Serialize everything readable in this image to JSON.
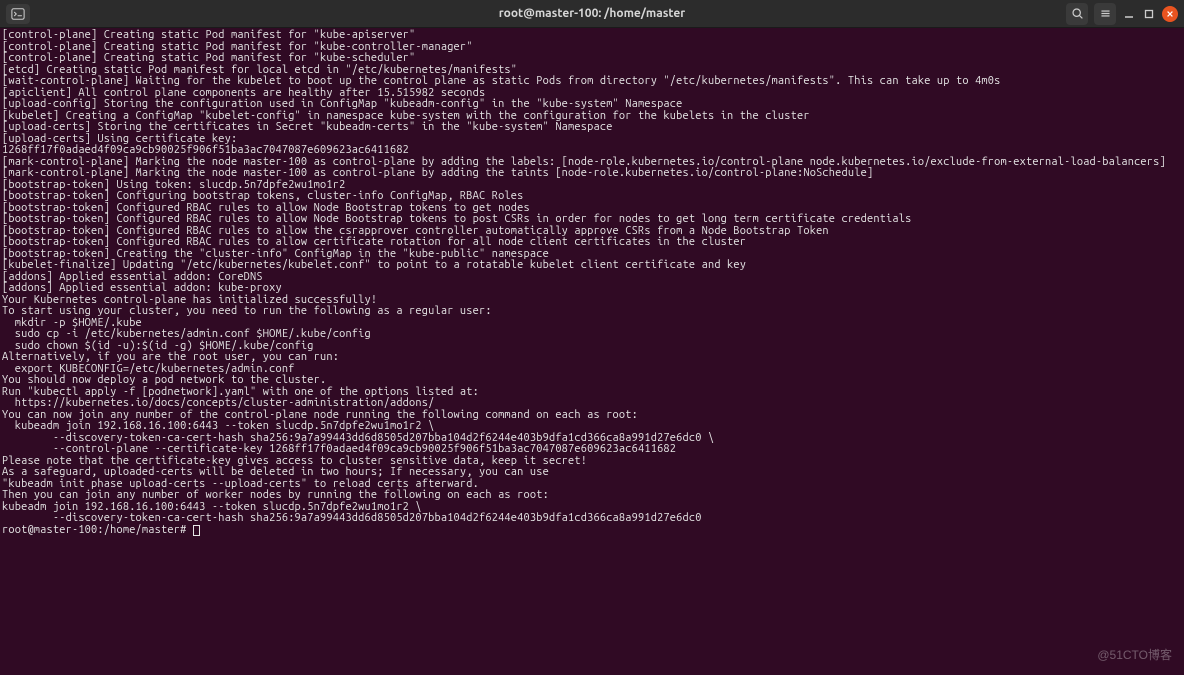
{
  "window": {
    "title": "root@master-100: /home/master"
  },
  "titlebar": {
    "newtab_icon": "⊕"
  },
  "watermark": "@51CTO博客",
  "terminal": {
    "lines": [
      "[control-plane] Creating static Pod manifest for \"kube-apiserver\"",
      "[control-plane] Creating static Pod manifest for \"kube-controller-manager\"",
      "[control-plane] Creating static Pod manifest for \"kube-scheduler\"",
      "[etcd] Creating static Pod manifest for local etcd in \"/etc/kubernetes/manifests\"",
      "[wait-control-plane] Waiting for the kubelet to boot up the control plane as static Pods from directory \"/etc/kubernetes/manifests\". This can take up to 4m0s",
      "[apiclient] All control plane components are healthy after 15.515982 seconds",
      "[upload-config] Storing the configuration used in ConfigMap \"kubeadm-config\" in the \"kube-system\" Namespace",
      "[kubelet] Creating a ConfigMap \"kubelet-config\" in namespace kube-system with the configuration for the kubelets in the cluster",
      "[upload-certs] Storing the certificates in Secret \"kubeadm-certs\" in the \"kube-system\" Namespace",
      "[upload-certs] Using certificate key:",
      "1268ff17f0adaed4f09ca9cb90025f906f51ba3ac7047087e609623ac6411682",
      "[mark-control-plane] Marking the node master-100 as control-plane by adding the labels: [node-role.kubernetes.io/control-plane node.kubernetes.io/exclude-from-external-load-balancers]",
      "[mark-control-plane] Marking the node master-100 as control-plane by adding the taints [node-role.kubernetes.io/control-plane:NoSchedule]",
      "[bootstrap-token] Using token: slucdp.5n7dpfe2wu1mo1r2",
      "[bootstrap-token] Configuring bootstrap tokens, cluster-info ConfigMap, RBAC Roles",
      "[bootstrap-token] Configured RBAC rules to allow Node Bootstrap tokens to get nodes",
      "[bootstrap-token] Configured RBAC rules to allow Node Bootstrap tokens to post CSRs in order for nodes to get long term certificate credentials",
      "[bootstrap-token] Configured RBAC rules to allow the csrapprover controller automatically approve CSRs from a Node Bootstrap Token",
      "[bootstrap-token] Configured RBAC rules to allow certificate rotation for all node client certificates in the cluster",
      "[bootstrap-token] Creating the \"cluster-info\" ConfigMap in the \"kube-public\" namespace",
      "[kubelet-finalize] Updating \"/etc/kubernetes/kubelet.conf\" to point to a rotatable kubelet client certificate and key",
      "[addons] Applied essential addon: CoreDNS",
      "[addons] Applied essential addon: kube-proxy",
      "",
      "Your Kubernetes control-plane has initialized successfully!",
      "",
      "To start using your cluster, you need to run the following as a regular user:",
      "",
      "  mkdir -p $HOME/.kube",
      "  sudo cp -i /etc/kubernetes/admin.conf $HOME/.kube/config",
      "  sudo chown $(id -u):$(id -g) $HOME/.kube/config",
      "",
      "Alternatively, if you are the root user, you can run:",
      "",
      "  export KUBECONFIG=/etc/kubernetes/admin.conf",
      "",
      "You should now deploy a pod network to the cluster.",
      "Run \"kubectl apply -f [podnetwork].yaml\" with one of the options listed at:",
      "  https://kubernetes.io/docs/concepts/cluster-administration/addons/",
      "",
      "You can now join any number of the control-plane node running the following command on each as root:",
      "",
      "  kubeadm join 192.168.16.100:6443 --token slucdp.5n7dpfe2wu1mo1r2 \\",
      "        --discovery-token-ca-cert-hash sha256:9a7a99443dd6d8505d207bba104d2f6244e403b9dfa1cd366ca8a991d27e6dc0 \\",
      "        --control-plane --certificate-key 1268ff17f0adaed4f09ca9cb90025f906f51ba3ac7047087e609623ac6411682",
      "",
      "Please note that the certificate-key gives access to cluster sensitive data, keep it secret!",
      "As a safeguard, uploaded-certs will be deleted in two hours; If necessary, you can use",
      "\"kubeadm init phase upload-certs --upload-certs\" to reload certs afterward.",
      "",
      "Then you can join any number of worker nodes by running the following on each as root:",
      "",
      "kubeadm join 192.168.16.100:6443 --token slucdp.5n7dpfe2wu1mo1r2 \\",
      "        --discovery-token-ca-cert-hash sha256:9a7a99443dd6d8505d207bba104d2f6244e403b9dfa1cd366ca8a991d27e6dc0"
    ],
    "prompt": "root@master-100:/home/master# "
  }
}
